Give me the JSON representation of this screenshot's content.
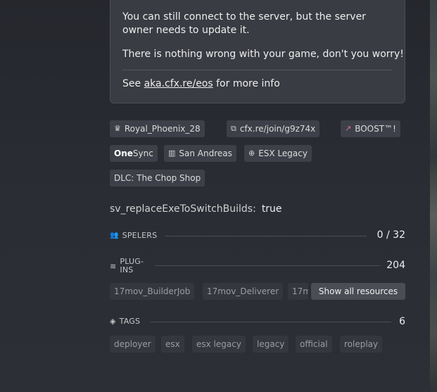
{
  "notice": {
    "line1": "You can still connect to the server, but the server owner needs to update it.",
    "line2": "There is nothing wrong with your game, don't you worry!",
    "line3_prefix": "See",
    "line3_link": "aka.cfx.re/eos",
    "line3_suffix": "for more info"
  },
  "chips": {
    "owner": "Royal_Phoenix_28",
    "join_link": "cfx.re/join/g9z74x",
    "boost": "BOOST™!",
    "onesync_bold": "One",
    "onesync_rest": "Sync",
    "map": "San Andreas",
    "gametype": "ESX Legacy",
    "dlc": "DLC: The Chop Shop"
  },
  "convar": {
    "key": "sv_replaceExeToSwitchBuilds:",
    "value": "true"
  },
  "players": {
    "label": "SPELERS",
    "count": "0 / 32"
  },
  "plugins": {
    "label_line1": "PLUG-",
    "label_line2": "INS",
    "count": "204",
    "items": [
      "17mov_BuilderJob",
      "17mov_Deliverer",
      "17m"
    ],
    "show_all": "Show all resources"
  },
  "tags": {
    "label": "TAGS",
    "count": "6",
    "items": [
      "deployer",
      "esx",
      "esx legacy",
      "legacy",
      "official",
      "roleplay"
    ]
  }
}
